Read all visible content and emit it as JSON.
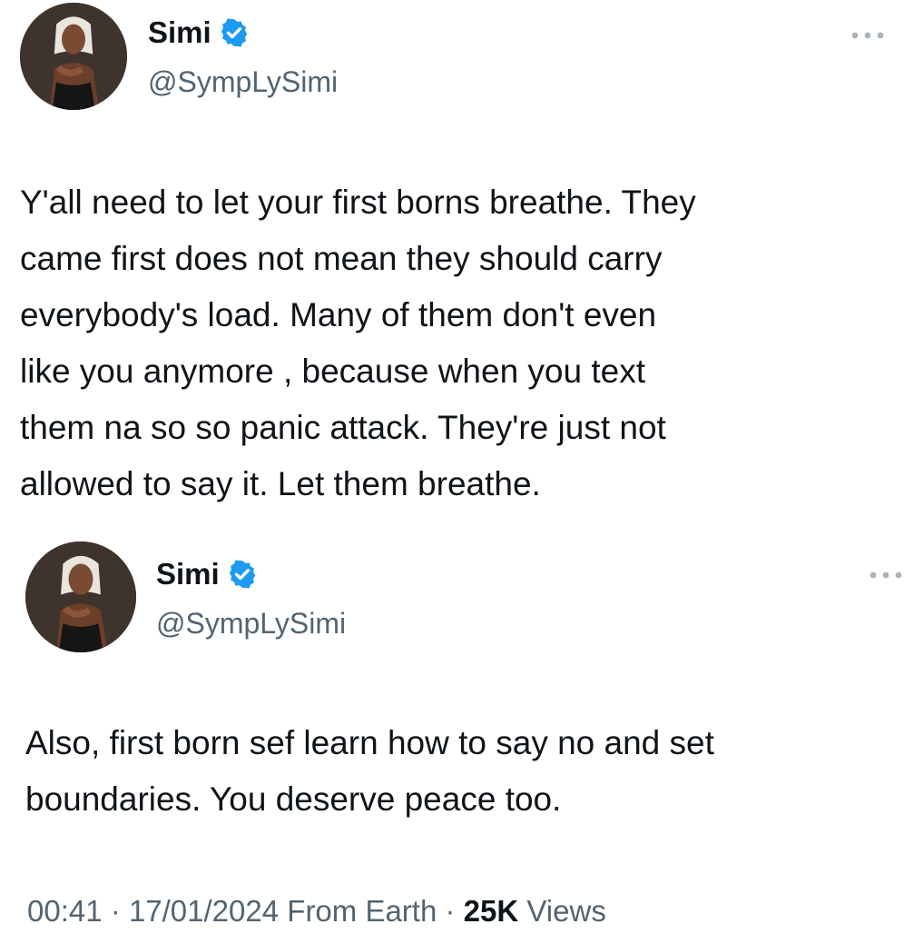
{
  "tweets": [
    {
      "author": {
        "display_name": "Simi",
        "handle": "@SympLySimi",
        "verified": true,
        "avatar_icon": "profile-photo"
      },
      "text": "Y'all need to let your first borns breathe. They\ncame first does not mean they should carry\neverybody's load. Many of them don't even\nlike you anymore , because when you text\nthem na so so panic attack. They're just not\nallowed to say it. Let them breathe.",
      "more_icon": "more-options-icon"
    },
    {
      "author": {
        "display_name": "Simi",
        "handle": "@SympLySimi",
        "verified": true,
        "avatar_icon": "profile-photo"
      },
      "text": "Also, first born sef learn how to say no and set\nboundaries. You deserve peace too.",
      "more_icon": "more-options-icon"
    }
  ],
  "meta": {
    "time": "00:41",
    "separator": "·",
    "date": "17/01/2024",
    "location": "From Earth",
    "views_count": "25K",
    "views_label": "Views"
  },
  "colors": {
    "verified_blue": "#1d9bf0",
    "secondary_text": "#536471",
    "primary_text": "#0f1419"
  }
}
